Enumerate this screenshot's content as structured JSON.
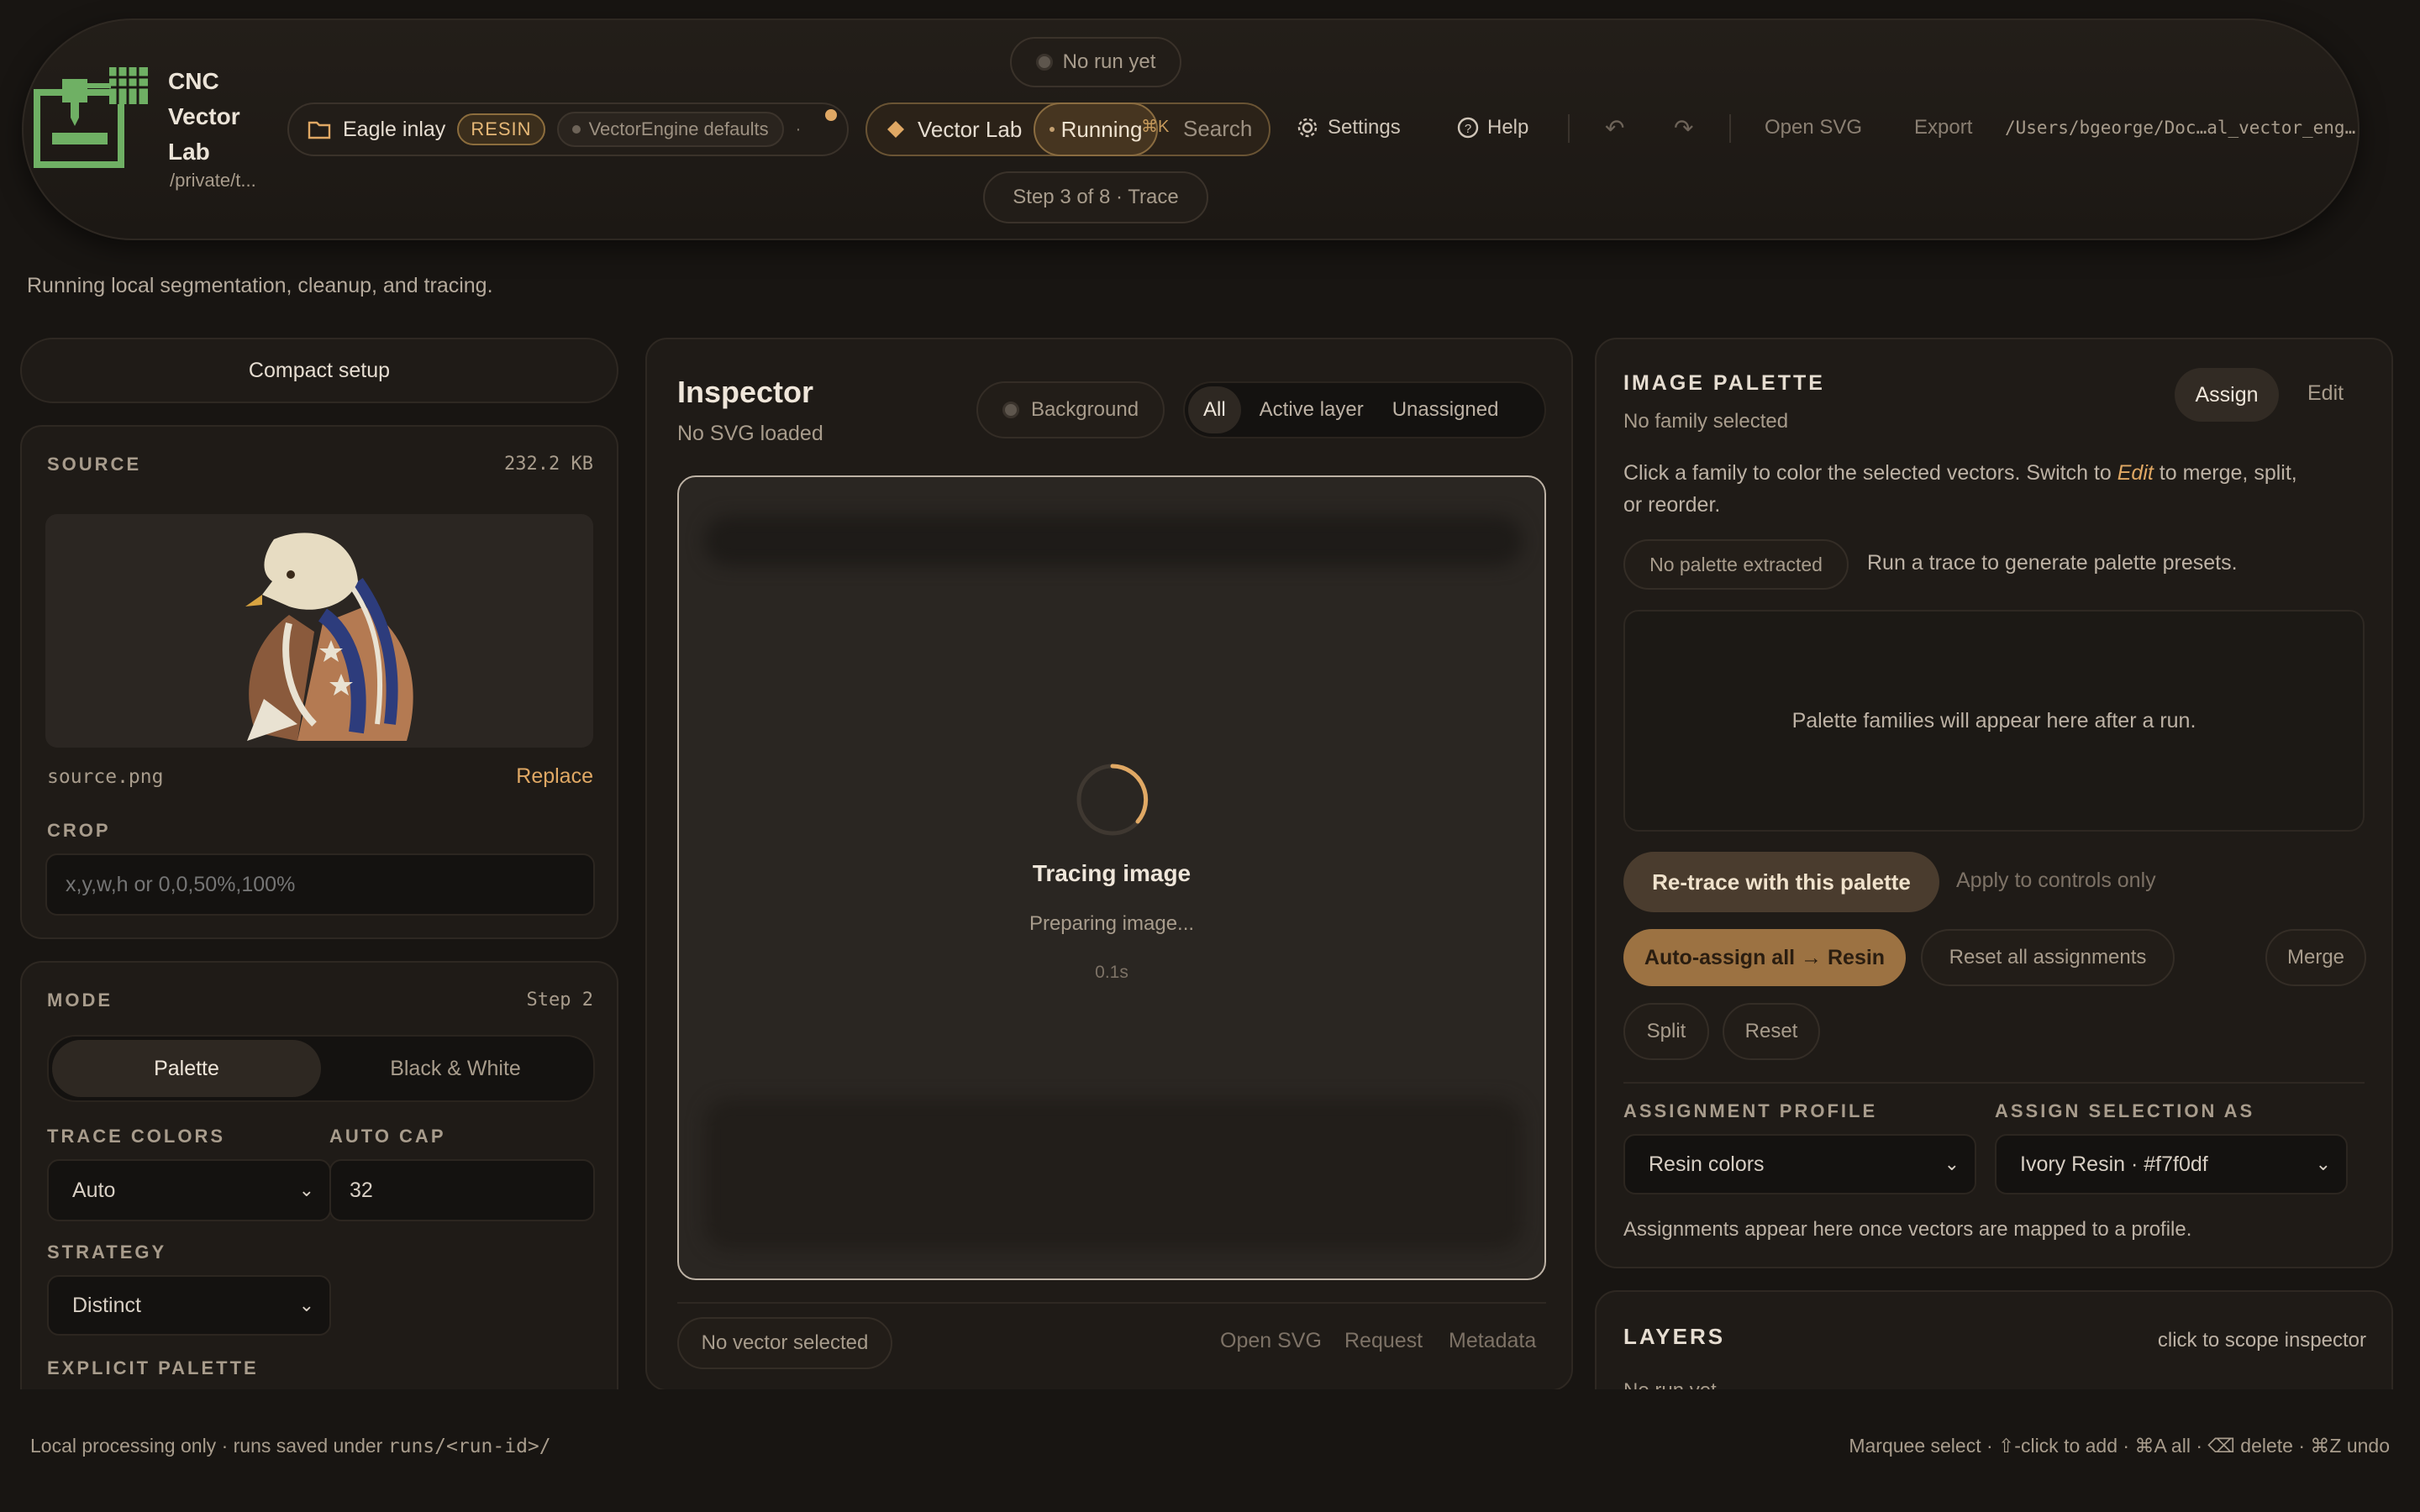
{
  "app": {
    "name_line1": "CNC",
    "name_line2": "Vector",
    "name_line3": "Lab",
    "path": "/private/t..."
  },
  "project": {
    "name": "Eagle inlay",
    "tag": "RESIN",
    "preset": "VectorEngine defaults"
  },
  "run_status": "No run yet",
  "step_indicator": "Step 3 of 8 · Trace",
  "nav": {
    "vector_lab": "Vector Lab",
    "running": "Running",
    "shortcut": "⌘K",
    "search": "Search",
    "settings": "Settings",
    "help": "Help",
    "open_svg": "Open SVG",
    "export": "Export",
    "file_path": "/Users/bgeorge/Doc…al_vector_eng…"
  },
  "status_message": "Running local segmentation, cleanup, and tracing.",
  "left": {
    "compact_setup": "Compact setup",
    "source": {
      "label": "SOURCE",
      "size": "232.2 KB",
      "filename": "source.png",
      "replace": "Replace"
    },
    "crop": {
      "label": "CROP",
      "placeholder": "x,y,w,h or 0,0,50%,100%"
    },
    "mode": {
      "label": "MODE",
      "step": "Step 2",
      "options": [
        "Palette",
        "Black & White"
      ],
      "selected": "Palette"
    },
    "trace_colors": {
      "label": "TRACE COLORS",
      "value": "Auto"
    },
    "auto_cap": {
      "label": "AUTO CAP",
      "value": "32"
    },
    "strategy": {
      "label": "STRATEGY",
      "value": "Distinct"
    },
    "explicit_palette": {
      "label": "EXPLICIT PALETTE"
    }
  },
  "inspector": {
    "title": "Inspector",
    "subtitle": "No SVG loaded",
    "background": "Background",
    "filters": [
      "All",
      "Active layer",
      "Unassigned"
    ],
    "active_filter": "All",
    "loading_title": "Tracing image",
    "loading_sub": "Preparing image...",
    "elapsed": "0.1s",
    "selection": "No vector selected",
    "links": [
      "Open SVG",
      "Request",
      "Metadata"
    ]
  },
  "palette": {
    "title": "IMAGE PALETTE",
    "subtitle": "No family selected",
    "tabs": [
      "Assign",
      "Edit"
    ],
    "help_pre": "Click a family to color the selected vectors. Switch to ",
    "help_em": "Edit",
    "help_post": " to merge, split,",
    "help_line2": "or reorder.",
    "no_palette": "No palette extracted",
    "run_hint": "Run a trace to generate palette presets.",
    "empty": "Palette families will appear here after a run.",
    "retrace": "Re-trace with this palette",
    "apply_controls": "Apply to controls only",
    "auto_assign": "Auto-assign all → Resin",
    "reset_all": "Reset all assignments",
    "merge": "Merge",
    "split": "Split",
    "reset": "Reset",
    "profile_label": "ASSIGNMENT PROFILE",
    "profile_value": "Resin colors",
    "assign_label": "ASSIGN SELECTION AS",
    "assign_value": "Ivory Resin · #f7f0df",
    "assign_note": "Assignments appear here once vectors are mapped to a profile."
  },
  "layers": {
    "title": "LAYERS",
    "hint": "click to scope inspector",
    "empty": "No run yet"
  },
  "footer": {
    "left_text": "Local processing only · runs saved under ",
    "left_code": "runs/<run-id>/",
    "right": "Marquee select · ⇧-click to add · ⌘A all · ⌫ delete · ⌘Z undo"
  },
  "colors": {
    "accent": "#e0a864",
    "bg": "#181512",
    "panel": "#1f1b17",
    "brand_green": "#5fa35a"
  }
}
